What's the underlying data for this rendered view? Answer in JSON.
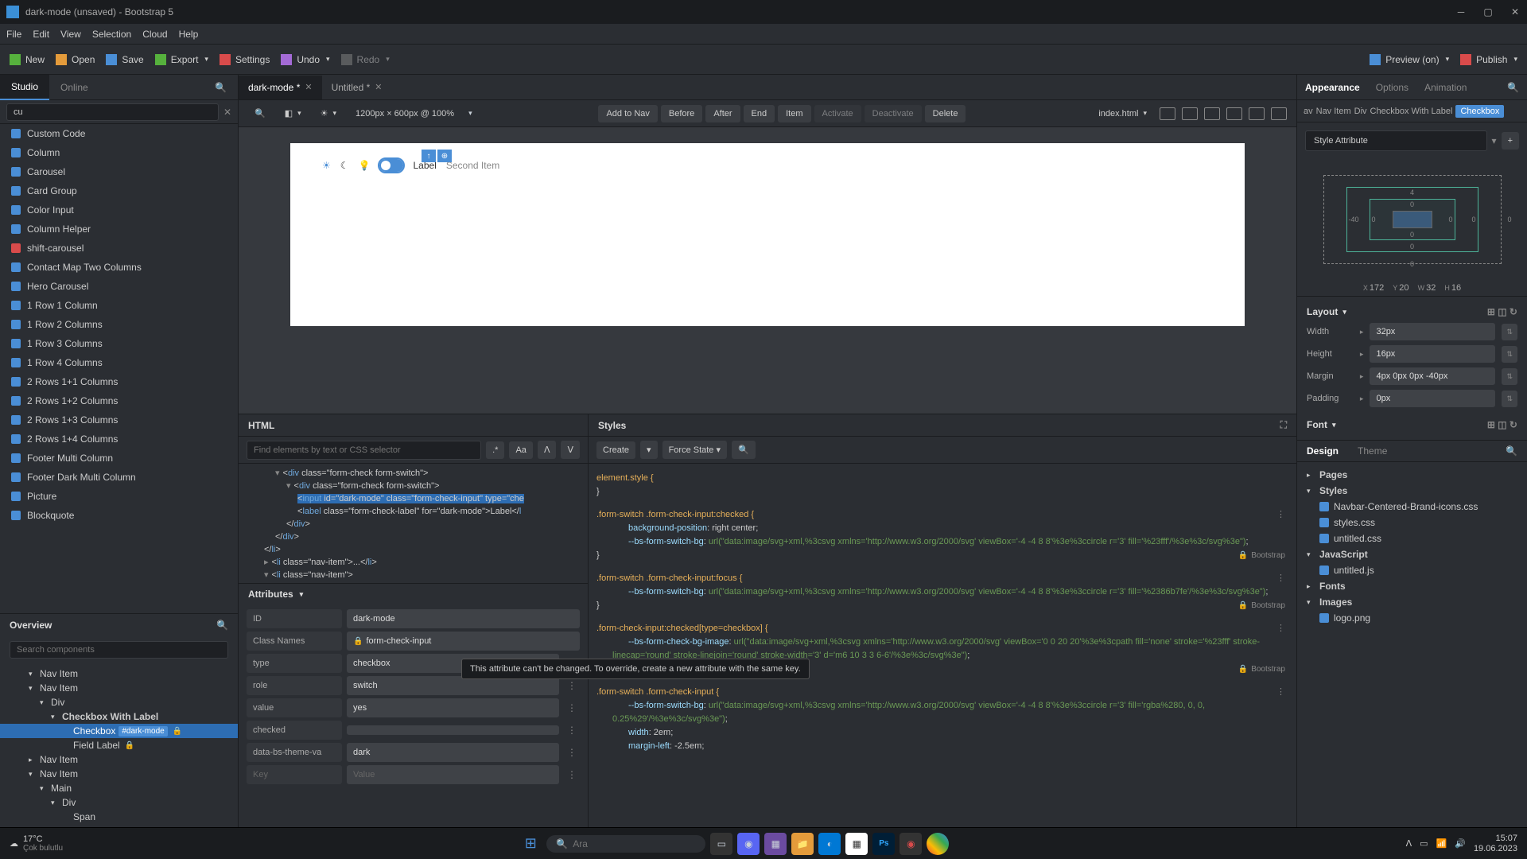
{
  "titlebar": {
    "title": "dark-mode (unsaved) - Bootstrap 5"
  },
  "menubar": [
    "File",
    "Edit",
    "View",
    "Selection",
    "Cloud",
    "Help"
  ],
  "toolbar": {
    "new": "New",
    "open": "Open",
    "save": "Save",
    "export": "Export",
    "settings": "Settings",
    "undo": "Undo",
    "redo": "Redo",
    "preview": "Preview (on)",
    "publish": "Publish"
  },
  "sidebar_tabs": {
    "studio": "Studio",
    "online": "Online"
  },
  "sidebar_filter": "cu",
  "components": [
    "Custom Code",
    "Column",
    "Carousel",
    "Card Group",
    "Color Input",
    "Column Helper",
    "shift-carousel",
    "Contact Map Two Columns",
    "Hero Carousel",
    "1 Row 1 Column",
    "1 Row 2 Columns",
    "1 Row 3 Columns",
    "1 Row 4 Columns",
    "2 Rows 1+1 Columns",
    "2 Rows 1+2 Columns",
    "2 Rows 1+3 Columns",
    "2 Rows 1+4 Columns",
    "Footer Multi Column",
    "Footer Dark Multi Column",
    "Picture",
    "Blockquote"
  ],
  "overview": {
    "title": "Overview",
    "search_placeholder": "Search components",
    "tree": [
      {
        "label": "Nav Item",
        "indent": 2,
        "caret": "▾"
      },
      {
        "label": "Nav Item",
        "indent": 2,
        "caret": "▾"
      },
      {
        "label": "Div",
        "indent": 3,
        "caret": "▾"
      },
      {
        "label": "Checkbox With Label",
        "indent": 4,
        "caret": "▾",
        "bold": true
      },
      {
        "label": "Checkbox",
        "badge": "#dark-mode",
        "indent": 5,
        "selected": true,
        "lock": true
      },
      {
        "label": "Field Label",
        "indent": 5,
        "lock": true
      },
      {
        "label": "Nav Item",
        "indent": 2,
        "caret": "▸"
      },
      {
        "label": "Nav Item",
        "indent": 2,
        "caret": "▾"
      },
      {
        "label": "Main",
        "indent": 3,
        "caret": "▾"
      },
      {
        "label": "Div",
        "indent": 4,
        "caret": "▾"
      },
      {
        "label": "Span",
        "indent": 5
      }
    ]
  },
  "doc_tabs": [
    {
      "label": "dark-mode *",
      "active": true
    },
    {
      "label": "Untitled *",
      "active": false
    }
  ],
  "canvas_toolbar": {
    "zoom": "1200px × 600px @ 100%",
    "buttons": [
      "Add to Nav",
      "Before",
      "After",
      "End",
      "Item",
      "Activate",
      "Deactivate",
      "Delete"
    ],
    "file": "index.html"
  },
  "canvas": {
    "label": "Label",
    "second_item": "Second Item"
  },
  "html_panel": {
    "title": "HTML",
    "search_placeholder": "Find elements by text or CSS selector",
    "lines": [
      {
        "indent": 3,
        "caret": "▾",
        "html": "<div class=\"form-check form-switch\">"
      },
      {
        "indent": 4,
        "caret": "▾",
        "html": "<div class=\"form-check form-switch\">",
        "hl_val": true
      },
      {
        "indent": 5,
        "html": "<input id=\"dark-mode\" class=\"form-check-input\" type=\"che",
        "selected": true
      },
      {
        "indent": 5,
        "html": "<label class=\"form-check-label\" for=\"dark-mode\">Label</l"
      },
      {
        "indent": 4,
        "html": "</div>"
      },
      {
        "indent": 3,
        "html": "</div>"
      },
      {
        "indent": 2,
        "html": "</li>"
      },
      {
        "indent": 2,
        "caret": "▸",
        "html": "<li class=\"nav-item\">...</li>"
      },
      {
        "indent": 2,
        "caret": "▾",
        "html": "<li class=\"nav-item\">"
      }
    ]
  },
  "attributes": {
    "title": "Attributes",
    "rows": [
      {
        "key": "ID",
        "val": "dark-mode"
      },
      {
        "key": "Class Names",
        "val": "form-check-input",
        "lock": true
      },
      {
        "key": "type",
        "val": "checkbox",
        "menu": true,
        "tooltip": true
      },
      {
        "key": "role",
        "val": "switch",
        "menu": true
      },
      {
        "key": "value",
        "val": "yes",
        "menu": true
      },
      {
        "key": "checked",
        "val": "",
        "menu": true
      },
      {
        "key": "data-bs-theme-va",
        "val": "dark",
        "menu": true
      },
      {
        "key": "",
        "key_placeholder": "Key",
        "val": "",
        "val_placeholder": "Value",
        "menu": true
      }
    ],
    "tooltip_text": "This attribute can't be changed. To override, create a new attribute with the same key."
  },
  "styles_panel": {
    "title": "Styles",
    "create": "Create",
    "force_state": "Force State",
    "blocks": [
      {
        "selector": "element.style {",
        "body": [],
        "close": "}"
      },
      {
        "selector": ".form-switch .form-check-input:checked {",
        "body": [
          "background-position: right center;",
          "--bs-form-switch-bg: url(\"data:image/svg+xml,%3csvg xmlns='http://www.w3.org/2000/svg' viewBox='-4 -4 8 8'%3e%3ccircle r='3' fill='%23fff'/%3e%3c/svg%3e\");"
        ],
        "close": "}",
        "source": "Bootstrap",
        "menu": true
      },
      {
        "selector": ".form-switch .form-check-input:focus {",
        "body": [
          "--bs-form-switch-bg: url(\"data:image/svg+xml,%3csvg xmlns='http://www.w3.org/2000/svg' viewBox='-4 -4 8 8'%3e%3ccircle r='3' fill='%2386b7fe'/%3e%3c/svg%3e\");"
        ],
        "close": "}",
        "source": "Bootstrap",
        "menu": true
      },
      {
        "selector": ".form-check-input:checked[type=checkbox] {",
        "body": [
          "--bs-form-check-bg-image: url(\"data:image/svg+xml,%3csvg xmlns='http://www.w3.org/2000/svg' viewBox='0 0 20 20'%3e%3cpath fill='none' stroke='%23fff' stroke-linecap='round' stroke-linejoin='round' stroke-width='3' d='m6 10 3 3 6-6'/%3e%3c/svg%3e\");"
        ],
        "close": "}",
        "source": "Bootstrap",
        "menu": true
      },
      {
        "selector": ".form-switch .form-check-input {",
        "body": [
          "--bs-form-switch-bg: url(\"data:image/svg+xml,%3csvg xmlns='http://www.w3.org/2000/svg' viewBox='-4 -4 8 8'%3e%3ccircle r='3' fill='rgba%280, 0, 0, 0.25%29'/%3e%3c/svg%3e\");",
          "width: 2em;",
          "margin-left: -2.5em;"
        ],
        "close": "",
        "menu": true
      }
    ]
  },
  "right_tabs": [
    "Appearance",
    "Options",
    "Animation"
  ],
  "breadcrumb": [
    "av",
    "Nav Item",
    "Div",
    "Checkbox With Label",
    "Checkbox"
  ],
  "style_attribute": "Style Attribute",
  "box_model": {
    "margin": {
      "top": "4",
      "right": "0",
      "bottom": "0",
      "left": "-40"
    },
    "padding": {
      "top": "0",
      "right": "0",
      "bottom": "0",
      "left": "0"
    },
    "position": {
      "top": "0",
      "right": "0"
    },
    "dims": {
      "x": "172",
      "y": "20",
      "w": "32",
      "h": "16"
    }
  },
  "layout": {
    "title": "Layout",
    "rows": [
      {
        "label": "Width",
        "val": "32px"
      },
      {
        "label": "Height",
        "val": "16px"
      },
      {
        "label": "Margin",
        "val": "4px 0px 0px -40px"
      },
      {
        "label": "Padding",
        "val": "0px"
      }
    ],
    "font": "Font"
  },
  "design_tabs": [
    "Design",
    "Theme"
  ],
  "design_tree": [
    {
      "label": "Pages",
      "caret": "▸"
    },
    {
      "label": "Styles",
      "caret": "▾",
      "children": [
        "Navbar-Centered-Brand-icons.css",
        "styles.css",
        "untitled.css"
      ]
    },
    {
      "label": "JavaScript",
      "caret": "▾",
      "children": [
        "untitled.js"
      ]
    },
    {
      "label": "Fonts",
      "caret": "▸"
    },
    {
      "label": "Images",
      "caret": "▾",
      "children": [
        "logo.png"
      ]
    }
  ],
  "taskbar": {
    "temp": "17°C",
    "weather": "Çok bulutlu",
    "search": "Ara",
    "time": "15:07",
    "date": "19.06.2023"
  }
}
